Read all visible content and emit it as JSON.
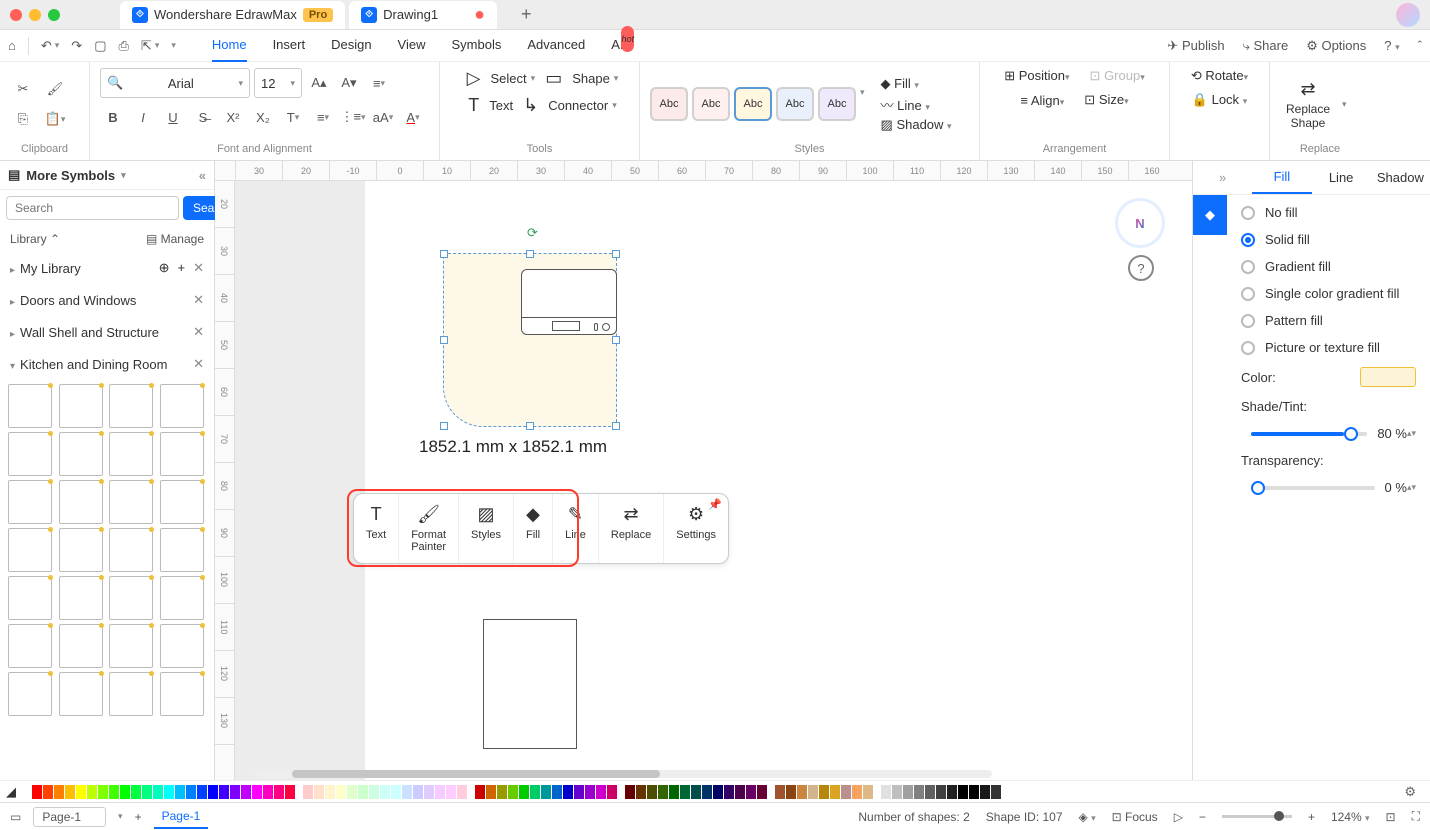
{
  "titlebar": {
    "app_name": "Wondershare EdrawMax",
    "pro": "Pro",
    "doc_tab": "Drawing1",
    "add": "+"
  },
  "toptool": {
    "publish": "Publish",
    "share": "Share",
    "options": "Options"
  },
  "menu": {
    "home": "Home",
    "insert": "Insert",
    "design": "Design",
    "view": "View",
    "symbols": "Symbols",
    "advanced": "Advanced",
    "ai": "AI",
    "hot": "hot"
  },
  "ribbon": {
    "clipboard": "Clipboard",
    "font_alignment": "Font and Alignment",
    "font_name": "Arial",
    "font_size": "12",
    "tools": "Tools",
    "select": "Select",
    "shape": "Shape",
    "text": "Text",
    "connector": "Connector",
    "styles": "Styles",
    "abc": "Abc",
    "fill": "Fill",
    "line": "Line",
    "shadow": "Shadow",
    "arrangement": "Arrangement",
    "position": "Position",
    "group": "Group",
    "align": "Align",
    "size": "Size",
    "rotate": "Rotate",
    "lock": "Lock",
    "replace": "Replace",
    "replace_shape": "Replace\nShape"
  },
  "sidebar": {
    "more_symbols": "More Symbols",
    "search_btn": "Search",
    "search_ph": "Search",
    "library": "Library",
    "manage": "Manage",
    "my_library": "My Library",
    "cats": [
      "Doors and Windows",
      "Wall Shell and Structure",
      "Kitchen and Dining Room"
    ]
  },
  "canvas": {
    "hruler": [
      "30",
      "20",
      "-10",
      "0",
      "10",
      "20",
      "30",
      "40",
      "50",
      "60",
      "70",
      "80",
      "90",
      "100",
      "110",
      "120",
      "130",
      "140",
      "150",
      "160"
    ],
    "vruler": [
      "20",
      "30",
      "40",
      "50",
      "60",
      "70",
      "80",
      "90",
      "100",
      "110",
      "120",
      "130"
    ],
    "dim": "1852.1 mm x 1852.1 mm"
  },
  "float": {
    "text": "Text",
    "format_painter": "Format\nPainter",
    "styles": "Styles",
    "fill": "Fill",
    "line": "Line",
    "replace": "Replace",
    "settings": "Settings"
  },
  "rightpane": {
    "tabs": {
      "fill": "Fill",
      "line": "Line",
      "shadow": "Shadow"
    },
    "no_fill": "No fill",
    "solid_fill": "Solid fill",
    "gradient_fill": "Gradient fill",
    "single_gradient": "Single color gradient fill",
    "pattern_fill": "Pattern fill",
    "picture_fill": "Picture or texture fill",
    "color": "Color:",
    "shade": "Shade/Tint:",
    "shade_val": "80 %",
    "transparency": "Transparency:",
    "trans_val": "0 %"
  },
  "status": {
    "page": "Page-1",
    "tab": "Page-1",
    "shapes": "Number of shapes: 2",
    "shape_id": "Shape ID: 107",
    "focus": "Focus",
    "zoom": "124%"
  },
  "color_strip": [
    "#ffffff",
    "#ff0000",
    "#ff4000",
    "#ff8000",
    "#ffbf00",
    "#ffff00",
    "#bfff00",
    "#80ff00",
    "#40ff00",
    "#00ff00",
    "#00ff40",
    "#00ff80",
    "#00ffbf",
    "#00ffff",
    "#00bfff",
    "#0080ff",
    "#0040ff",
    "#0000ff",
    "#4000ff",
    "#8000ff",
    "#bf00ff",
    "#ff00ff",
    "#ff00bf",
    "#ff0080",
    "#ff0040",
    "#fff",
    "#ffcccc",
    "#ffe0cc",
    "#fff5cc",
    "#ffffcc",
    "#e0ffcc",
    "#ccffcc",
    "#ccffe0",
    "#ccfff5",
    "#ccffff",
    "#cce0ff",
    "#ccccff",
    "#e0ccff",
    "#f5ccff",
    "#ffccff",
    "#ffcce0",
    "#fff",
    "#cc0000",
    "#cc6600",
    "#999900",
    "#66cc00",
    "#00cc00",
    "#00cc66",
    "#009999",
    "#0066cc",
    "#0000cc",
    "#6600cc",
    "#9900cc",
    "#cc00cc",
    "#cc0066",
    "#fff",
    "#660000",
    "#663300",
    "#4d4d00",
    "#336600",
    "#006600",
    "#006633",
    "#004d4d",
    "#003366",
    "#000066",
    "#330066",
    "#4d004d",
    "#660066",
    "#660033",
    "#fff",
    "#a0522d",
    "#8b4513",
    "#cd853f",
    "#d2b48c",
    "#b8860b",
    "#daa520",
    "#bc8f8f",
    "#f4a460",
    "#deb887",
    "#fff",
    "#e0e0e0",
    "#c0c0c0",
    "#a0a0a0",
    "#808080",
    "#606060",
    "#404040",
    "#202020",
    "#000000",
    "#000000",
    "#1a1a1a",
    "#333333"
  ]
}
